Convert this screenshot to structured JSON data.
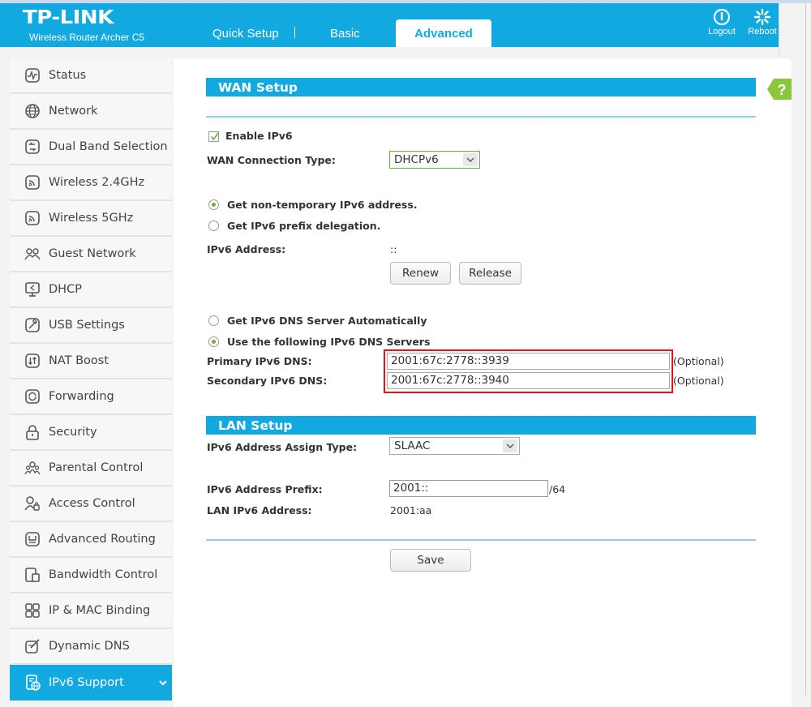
{
  "header": {
    "brand": "TP-LINK",
    "model": "Wireless Router Archer C5",
    "nav": [
      "Quick Setup",
      "Basic",
      "Advanced"
    ],
    "active_tab": "Advanced",
    "logout_label": "Logout",
    "reboot_label": "Reboot"
  },
  "sidebar": {
    "items": [
      {
        "label": "Status",
        "icon": "status-icon"
      },
      {
        "label": "Network",
        "icon": "globe-icon"
      },
      {
        "label": "Dual Band Selection",
        "icon": "dual-band-icon"
      },
      {
        "label": "Wireless 2.4GHz",
        "icon": "wireless-icon"
      },
      {
        "label": "Wireless 5GHz",
        "icon": "wireless-icon"
      },
      {
        "label": "Guest Network",
        "icon": "guest-network-icon"
      },
      {
        "label": "DHCP",
        "icon": "dhcp-icon"
      },
      {
        "label": "USB Settings",
        "icon": "usb-icon"
      },
      {
        "label": "NAT Boost",
        "icon": "nat-boost-icon"
      },
      {
        "label": "Forwarding",
        "icon": "forwarding-icon"
      },
      {
        "label": "Security",
        "icon": "lock-icon"
      },
      {
        "label": "Parental Control",
        "icon": "parental-control-icon"
      },
      {
        "label": "Access Control",
        "icon": "access-control-icon"
      },
      {
        "label": "Advanced Routing",
        "icon": "routing-icon"
      },
      {
        "label": "Bandwidth Control",
        "icon": "bandwidth-icon"
      },
      {
        "label": "IP & MAC Binding",
        "icon": "binding-icon"
      },
      {
        "label": "Dynamic DNS",
        "icon": "ddns-icon"
      },
      {
        "label": "IPv6 Support",
        "icon": "ipv6-icon",
        "active": true
      }
    ]
  },
  "wan": {
    "title": "WAN Setup",
    "enable_label": "Enable IPv6",
    "enable_checked": true,
    "conn_type_label": "WAN Connection Type:",
    "conn_type_value": "DHCPv6",
    "addr_options": [
      "Get non-temporary IPv6 address.",
      "Get IPv6 prefix delegation."
    ],
    "addr_selected": 0,
    "ipv6_addr_label": "IPv6 Address:",
    "ipv6_addr_value": "::",
    "renew_label": "Renew",
    "release_label": "Release",
    "dns_options": [
      "Get IPv6 DNS Server Automatically",
      "Use the following IPv6 DNS Servers"
    ],
    "dns_selected": 1,
    "primary_dns_label": "Primary IPv6 DNS:",
    "primary_dns_value": "2001:67c:2778::3939",
    "secondary_dns_label": "Secondary IPv6 DNS:",
    "secondary_dns_value": "2001:67c:2778::3940",
    "optional_label": "(Optional)"
  },
  "lan": {
    "title": "LAN Setup",
    "assign_type_label": "IPv6 Address Assign Type:",
    "assign_type_value": "SLAAC",
    "prefix_label": "IPv6 Address Prefix:",
    "prefix_value": "2001::",
    "prefix_len": "/64",
    "lan_addr_label": "LAN IPv6 Address:",
    "lan_addr_value": "2001:aa"
  },
  "save_label": "Save",
  "help_label": "?",
  "colors": {
    "accent": "#12a8e0",
    "help": "#8cc63f",
    "highlight": "#e3141b",
    "radio_on": "#6bb531"
  }
}
